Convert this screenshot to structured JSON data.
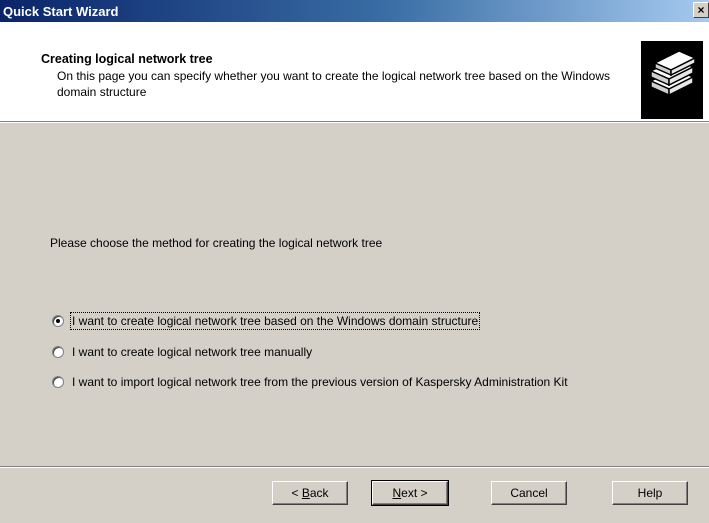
{
  "window": {
    "title": "Quick Start Wizard",
    "close_label": "×"
  },
  "header": {
    "title": "Creating logical network tree",
    "description": "On this page you can specify whether you want to create the logical network tree based on the Windows domain structure",
    "icon": "books-stack-icon"
  },
  "body": {
    "prompt": "Please choose the method for creating the logical network tree",
    "options": [
      {
        "label": "I want to create logical network tree based on the Windows domain structure",
        "selected": true
      },
      {
        "label": "I want to create logical network tree manually",
        "selected": false
      },
      {
        "label": "I want to import logical network tree from the previous version of Kaspersky Administration Kit",
        "selected": false
      }
    ]
  },
  "buttons": {
    "back_prefix": "< ",
    "back_access": "B",
    "back_rest": "ack",
    "next_access": "N",
    "next_rest": "ext >",
    "cancel": "Cancel",
    "help": "Help"
  }
}
